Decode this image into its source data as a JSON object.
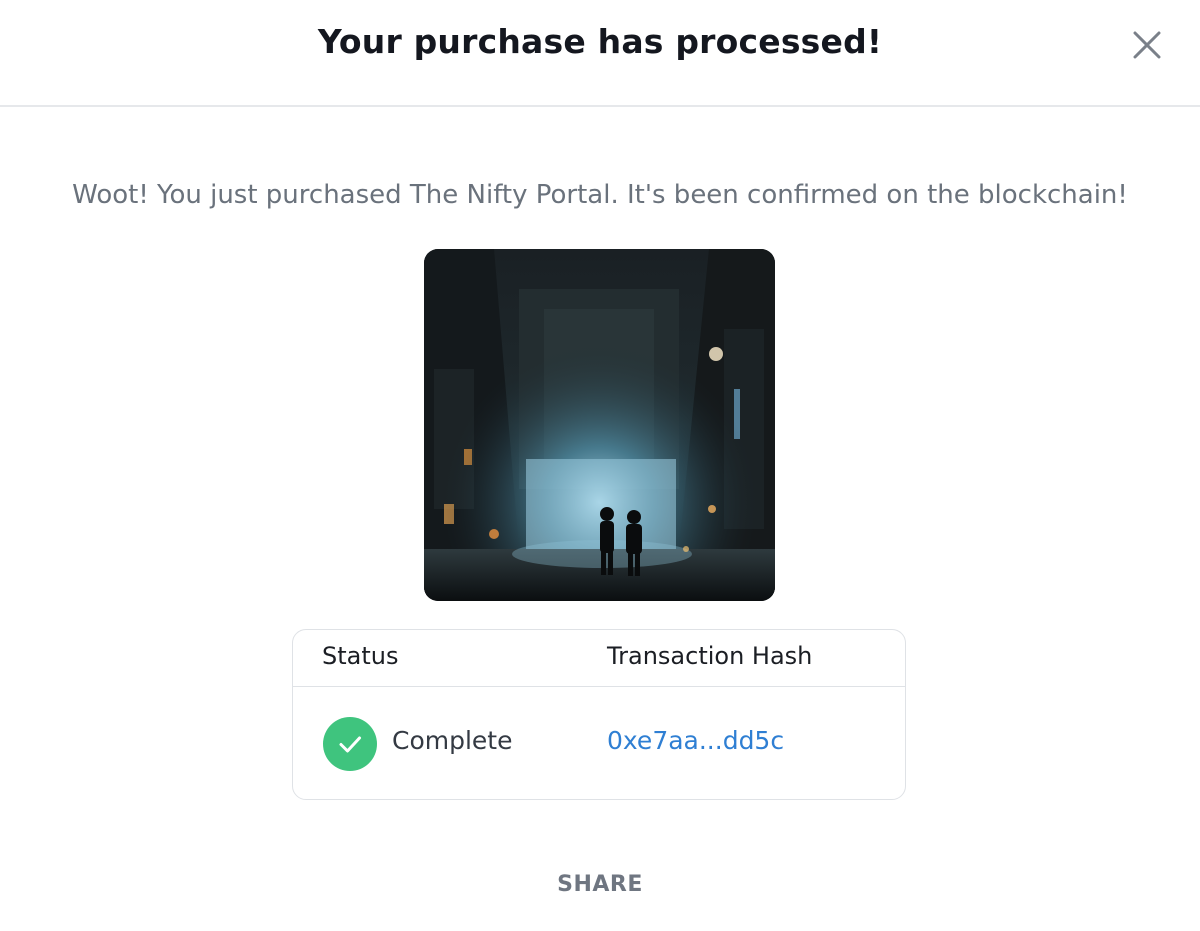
{
  "header": {
    "title": "Your purchase has processed!",
    "close_icon": "close-icon"
  },
  "message": "Woot! You just purchased The Nifty Portal. It's been confirmed on the blockchain!",
  "nft": {
    "image_description_icon": "nft-artwork"
  },
  "table": {
    "col_status": "Status",
    "col_hash": "Transaction Hash",
    "status_value": "Complete",
    "status_icon": "check-circle-icon",
    "hash_value": "0xe7aa...dd5c"
  },
  "actions": {
    "share_label": "SHARE"
  },
  "colors": {
    "success": "#3fc47e",
    "link": "#2f7fd3",
    "title": "#14171f",
    "muted": "#6a727c"
  }
}
